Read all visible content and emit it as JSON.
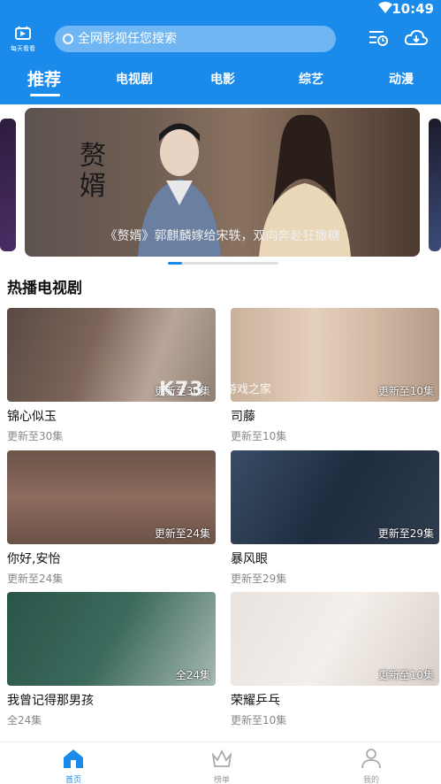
{
  "status": {
    "time": "10:49"
  },
  "logo": {
    "text": "每天看看"
  },
  "search": {
    "placeholder": "全网影视任您搜索"
  },
  "tabs": [
    "推荐",
    "电视剧",
    "电影",
    "综艺",
    "动漫"
  ],
  "banner": {
    "title_art": "赘婿",
    "caption": "《赘婿》郭麒麟嫁给宋轶，双向奔赴狂撒糖"
  },
  "section": {
    "title": "热播电视剧"
  },
  "shows": [
    {
      "name": "锦心似玉",
      "sub": "更新至30集",
      "badge": "更新至30集"
    },
    {
      "name": "司藤",
      "sub": "更新至10集",
      "badge": "更新至10集"
    },
    {
      "name": "你好,安怡",
      "sub": "更新至24集",
      "badge": "更新至24集"
    },
    {
      "name": "暴风眼",
      "sub": "更新至29集",
      "badge": "更新至29集"
    },
    {
      "name": "我曾记得那男孩",
      "sub": "全24集",
      "badge": "全24集"
    },
    {
      "name": "荣耀乒乓",
      "sub": "更新至10集",
      "badge": "更新至10集"
    }
  ],
  "watermark": {
    "logo": "K73",
    "text": "游戏之家"
  },
  "bottom_nav": [
    {
      "label": "首页"
    },
    {
      "label": "榜单"
    },
    {
      "label": "我的"
    }
  ],
  "colors": {
    "accent": "#1a8bea"
  }
}
